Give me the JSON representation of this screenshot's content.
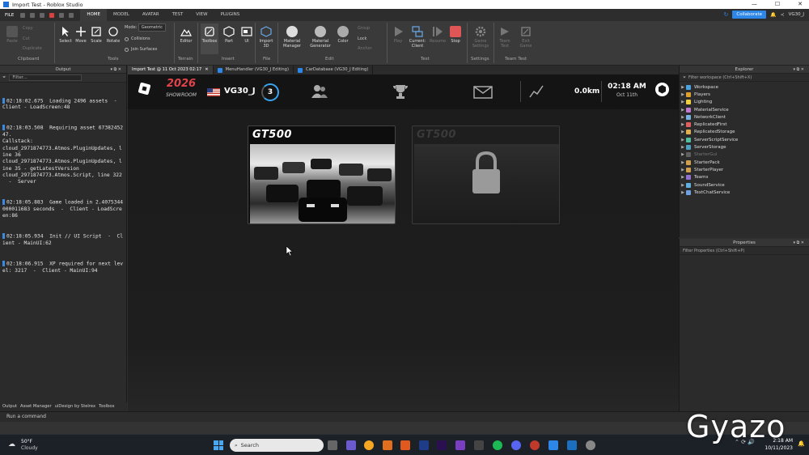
{
  "window": {
    "title": "Import Test - Roblox Studio"
  },
  "menubar": {
    "file": "FILE",
    "tabs": [
      "HOME",
      "MODEL",
      "AVATAR",
      "TEST",
      "VIEW",
      "PLUGINS"
    ],
    "collaborate": "Collaborate",
    "user": "VG30_J"
  },
  "ribbon": {
    "clipboard": {
      "paste": "Paste",
      "copy": "Copy",
      "cut": "Cut",
      "duplicate": "Duplicate",
      "label": "Clipboard"
    },
    "tools": {
      "select": "Select",
      "move": "Move",
      "scale": "Scale",
      "rotate": "Rotate",
      "mode_label": "Mode:",
      "mode_value": "Geometric",
      "collisions": "Collisions",
      "join_surfaces": "Join Surfaces",
      "label": "Tools"
    },
    "terrain": {
      "editor": "Editor",
      "label": "Terrain"
    },
    "insert": {
      "toolbox": "Toolbox",
      "part": "Part",
      "ui": "UI",
      "label": "Insert"
    },
    "file": {
      "import3d": "Import 3D",
      "label": "File"
    },
    "edit": {
      "material_manager": "Material Manager",
      "material_generator": "Material Generator",
      "color": "Color",
      "group": "Group",
      "lock": "Lock",
      "anchor": "Anchor",
      "label": "Edit"
    },
    "test": {
      "play": "Play",
      "current_client": "Current: Client",
      "resume": "Resume",
      "stop": "Stop",
      "label": "Test"
    },
    "settings": {
      "game_settings": "Game Settings",
      "label": "Settings"
    },
    "team_test": {
      "team_test": "Team Test",
      "exit_game": "Exit Game",
      "label": "Team Test"
    }
  },
  "output": {
    "title": "Output",
    "filter_placeholder": "Filter...",
    "logs": [
      {
        "time": "02:18:02.675",
        "text": "Loading 2496 assets  -  Client - LoadScreen:48"
      },
      {
        "time": "02:18:03.508",
        "text": "Requiring asset 6738245247.\nCallstack:\ncloud_2971874773.Atmos.PluginUpdates, line 36\ncloud_2971874773.Atmos.PluginUpdates, line 35 - getLatestVersion\ncloud_2971874773.Atmos.Script, line 322\n  -  Server"
      },
      {
        "time": "02:18:05.883",
        "text": "Game loaded in 2.4075344000011683 seconds  -  Client - LoadScreen:86"
      },
      {
        "time": "02:18:05.934",
        "text": "Init // UI Script  -  Client - MainUI:62"
      },
      {
        "time": "02:18:06.915",
        "text": "XP required for next level: 3217  -  Client - MainUI:94"
      }
    ],
    "bottom_tabs": [
      "Output",
      "Asset Manager",
      "uiDesign by Stelrex",
      "Toolbox"
    ]
  },
  "doc_tabs": [
    {
      "label": "Import Test @ 11 Oct 2023 02:17"
    },
    {
      "label": "MenuHandler (VG30_J Editing)"
    },
    {
      "label": "CarDatabase (VG30_J Editing)"
    }
  ],
  "game": {
    "logo_line1": "2026",
    "logo_line2": "SHOWROOM",
    "player_name": "VG30_J",
    "level": "3",
    "distance": "0.0km",
    "time": "02:18 AM",
    "date": "Oct 11th",
    "cards": [
      {
        "title": "GT500",
        "locked": false
      },
      {
        "title": "GT500",
        "locked": true
      }
    ]
  },
  "command_bar": {
    "placeholder": "Run a command"
  },
  "explorer": {
    "title": "Explorer",
    "filter_placeholder": "Filter workspace (Ctrl+Shift+X)",
    "items": [
      {
        "label": "Workspace",
        "color": "#4aa3df",
        "dim": false
      },
      {
        "label": "Players",
        "color": "#e0a030",
        "dim": false
      },
      {
        "label": "Lighting",
        "color": "#f0d040",
        "dim": false
      },
      {
        "label": "MaterialService",
        "color": "#c07ad0",
        "dim": false
      },
      {
        "label": "NetworkClient",
        "color": "#7ab0e0",
        "dim": false
      },
      {
        "label": "ReplicatedFirst",
        "color": "#e06060",
        "dim": false
      },
      {
        "label": "ReplicatedStorage",
        "color": "#e0b050",
        "dim": false
      },
      {
        "label": "ServerScriptService",
        "color": "#50c0a0",
        "dim": false
      },
      {
        "label": "ServerStorage",
        "color": "#50a0c0",
        "dim": false
      },
      {
        "label": "StarterGui",
        "color": "#606060",
        "dim": true
      },
      {
        "label": "StarterPack",
        "color": "#d0a050",
        "dim": false
      },
      {
        "label": "StarterPlayer",
        "color": "#d0a050",
        "dim": false
      },
      {
        "label": "Teams",
        "color": "#9070d0",
        "dim": false
      },
      {
        "label": "SoundService",
        "color": "#60b0e0",
        "dim": false
      },
      {
        "label": "TextChatService",
        "color": "#70a0e0",
        "dim": false
      }
    ]
  },
  "properties": {
    "title": "Properties",
    "filter_placeholder": "Filter Properties (Ctrl+Shift+P)"
  },
  "taskbar": {
    "weather_temp": "50°F",
    "weather_desc": "Cloudy",
    "search_placeholder": "Search",
    "clock_time": "2:18 AM",
    "clock_date": "10/11/2023"
  },
  "watermark": "Gyazo"
}
